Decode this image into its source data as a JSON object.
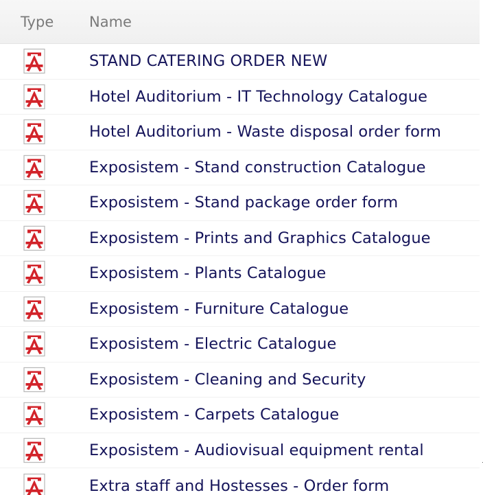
{
  "table": {
    "headers": {
      "type": "Type",
      "name": "Name"
    },
    "rows": [
      {
        "icon": "pdf-icon",
        "name": "STAND CATERING ORDER NEW"
      },
      {
        "icon": "pdf-icon",
        "name": "Hotel Auditorium - IT Technology Catalogue"
      },
      {
        "icon": "pdf-icon",
        "name": "Hotel Auditorium - Waste disposal order form"
      },
      {
        "icon": "pdf-icon",
        "name": "Exposistem - Stand construction Catalogue"
      },
      {
        "icon": "pdf-icon",
        "name": "Exposistem - Stand package order form"
      },
      {
        "icon": "pdf-icon",
        "name": "Exposistem - Prints and Graphics Catalogue"
      },
      {
        "icon": "pdf-icon",
        "name": "Exposistem - Plants Catalogue"
      },
      {
        "icon": "pdf-icon",
        "name": "Exposistem - Furniture Catalogue"
      },
      {
        "icon": "pdf-icon",
        "name": "Exposistem - Electric Catalogue"
      },
      {
        "icon": "pdf-icon",
        "name": "Exposistem - Cleaning and Security"
      },
      {
        "icon": "pdf-icon",
        "name": "Exposistem - Carpets Catalogue"
      },
      {
        "icon": "pdf-icon",
        "name": "Exposistem - Audiovisual equipment rental"
      },
      {
        "icon": "pdf-icon",
        "name": "Extra staff and Hostesses - Order form"
      }
    ]
  },
  "colors": {
    "link_text": "#15145a",
    "header_text": "#7a7a7a",
    "pdf_red": "#d2232a"
  }
}
